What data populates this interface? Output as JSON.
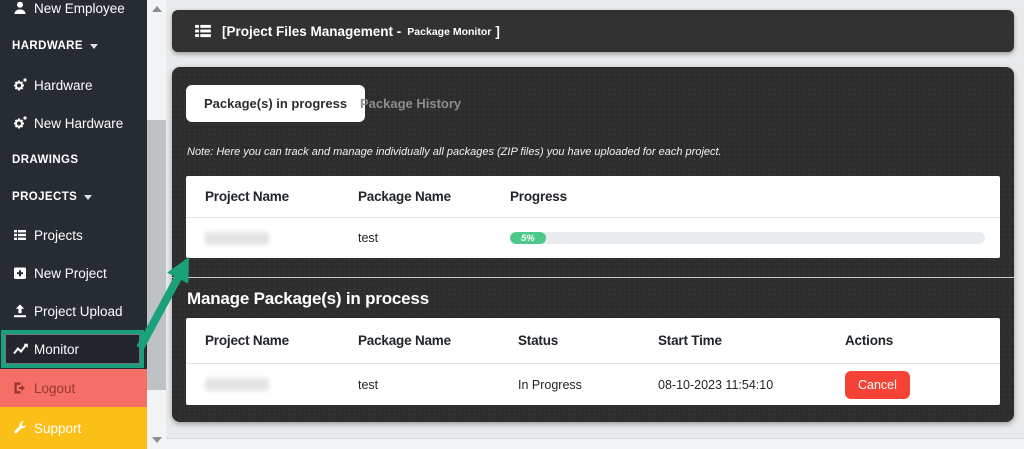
{
  "sidebar": {
    "items": [
      {
        "label": "New Employee",
        "icon": "person-icon"
      },
      {
        "label": "HARDWARE",
        "icon": "caret-down-icon"
      },
      {
        "label": "Hardware",
        "icon": "gear-icon"
      },
      {
        "label": "New Hardware",
        "icon": "gear-icon"
      },
      {
        "label": "DRAWINGS",
        "icon": "none"
      },
      {
        "label": "PROJECTS",
        "icon": "caret-down-icon"
      },
      {
        "label": "Projects",
        "icon": "list-icon"
      },
      {
        "label": "New Project",
        "icon": "plus-square-icon"
      },
      {
        "label": "Project Upload",
        "icon": "upload-icon"
      },
      {
        "label": "Monitor",
        "icon": "chart-line-icon",
        "highlighted": true
      },
      {
        "label": "Logout",
        "icon": "logout-icon",
        "bg": "#f66f67"
      },
      {
        "label": "Support",
        "icon": "wrench-icon",
        "bg": "#fcbf18"
      }
    ]
  },
  "header": {
    "title": "[Project Files Management -",
    "subtitle": "Package Monitor",
    "bracket": "]"
  },
  "tabs": {
    "active": "Package(s) in progress",
    "inactive": "Package History"
  },
  "note": "Note: Here you can track and manage individually all packages (ZIP files) you have uploaded for each project.",
  "progress_table": {
    "headers": [
      "Project Name",
      "Package Name",
      "Progress"
    ],
    "row": {
      "project_name_redacted": true,
      "package_name": "test",
      "progress_label": "5%",
      "progress_percent": 5
    }
  },
  "manage_section": {
    "title": "Manage Package(s) in process",
    "headers": [
      "Project Name",
      "Package Name",
      "Status",
      "Start Time",
      "Actions"
    ],
    "row": {
      "project_name_redacted": true,
      "package_name": "test",
      "status": "In Progress",
      "start_time": "08-10-2023 11:54:10",
      "action_label": "Cancel"
    }
  },
  "colors": {
    "annotation_green": "#1aa179",
    "logout_bg": "#f66f67",
    "support_bg": "#fcbf18",
    "progress_green": "#4bc98a",
    "cancel_red": "#f44336",
    "sidebar_bg": "#272c33",
    "panel_bg": "#2d2d2e"
  }
}
